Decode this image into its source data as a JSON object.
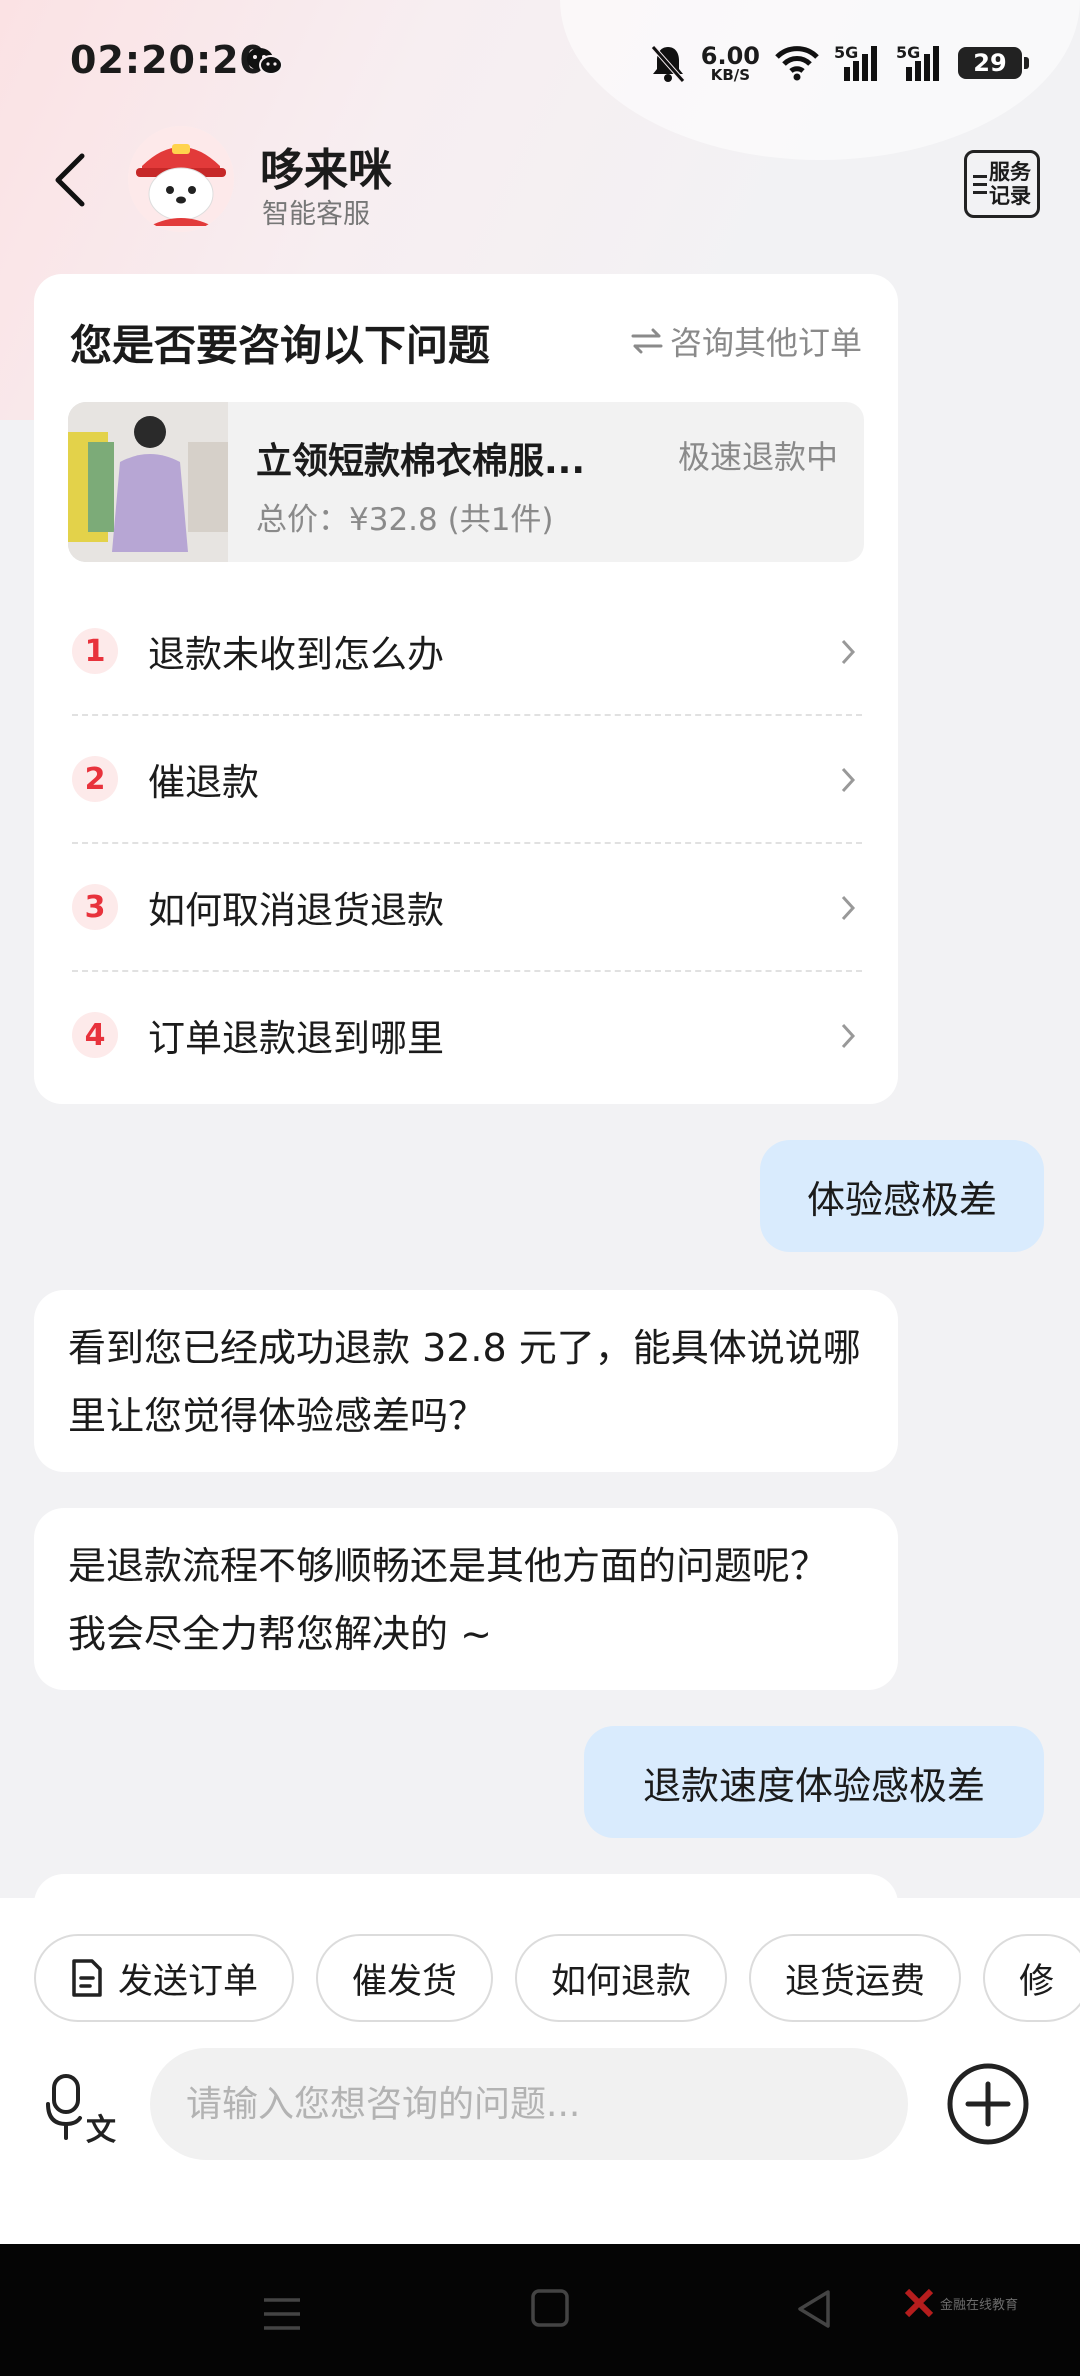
{
  "status_bar": {
    "time": "02:20:20",
    "net_speed_value": "6.00",
    "net_speed_unit": "KB/S",
    "sim1_label": "5G",
    "sim2_label": "5G",
    "battery": "29",
    "icons": [
      "wechat-icon",
      "bell-muted-icon",
      "wifi-icon",
      "signal-icon",
      "battery-icon"
    ]
  },
  "header": {
    "title": "哆来咪",
    "subtitle": "智能客服",
    "service_record_label_1": "服务",
    "service_record_label_2": "记录"
  },
  "question_card": {
    "title": "您是否要咨询以下问题",
    "other_order_label": "咨询其他订单",
    "order": {
      "name": "立领短款棉衣棉服...",
      "status": "极速退款中",
      "price": "总价：¥32.8 (共1件)"
    },
    "questions": [
      {
        "num": "1",
        "text": "退款未收到怎么办"
      },
      {
        "num": "2",
        "text": "催退款"
      },
      {
        "num": "3",
        "text": "如何取消退货退款"
      },
      {
        "num": "4",
        "text": "订单退款退到哪里"
      }
    ]
  },
  "messages": {
    "user_1": "体验感极差",
    "bot_1": "看到您已经成功退款 32.8 元了，能具体说说哪里让您觉得体验感差吗？",
    "bot_2": "是退款流程不够顺畅还是其他方面的问题呢？我会尽全力帮您解决的 ~",
    "user_2": "退款速度体验感极差"
  },
  "quick_actions": [
    "发送订单",
    "催发货",
    "如何退款",
    "退货运费",
    "修"
  ],
  "input": {
    "placeholder": "请输入您想咨询的问题..."
  },
  "watermark": "金融在线教育",
  "colors": {
    "accent_red": "#e8323c",
    "user_bubble": "#d9ebfd",
    "background": "#f2f2f4"
  }
}
